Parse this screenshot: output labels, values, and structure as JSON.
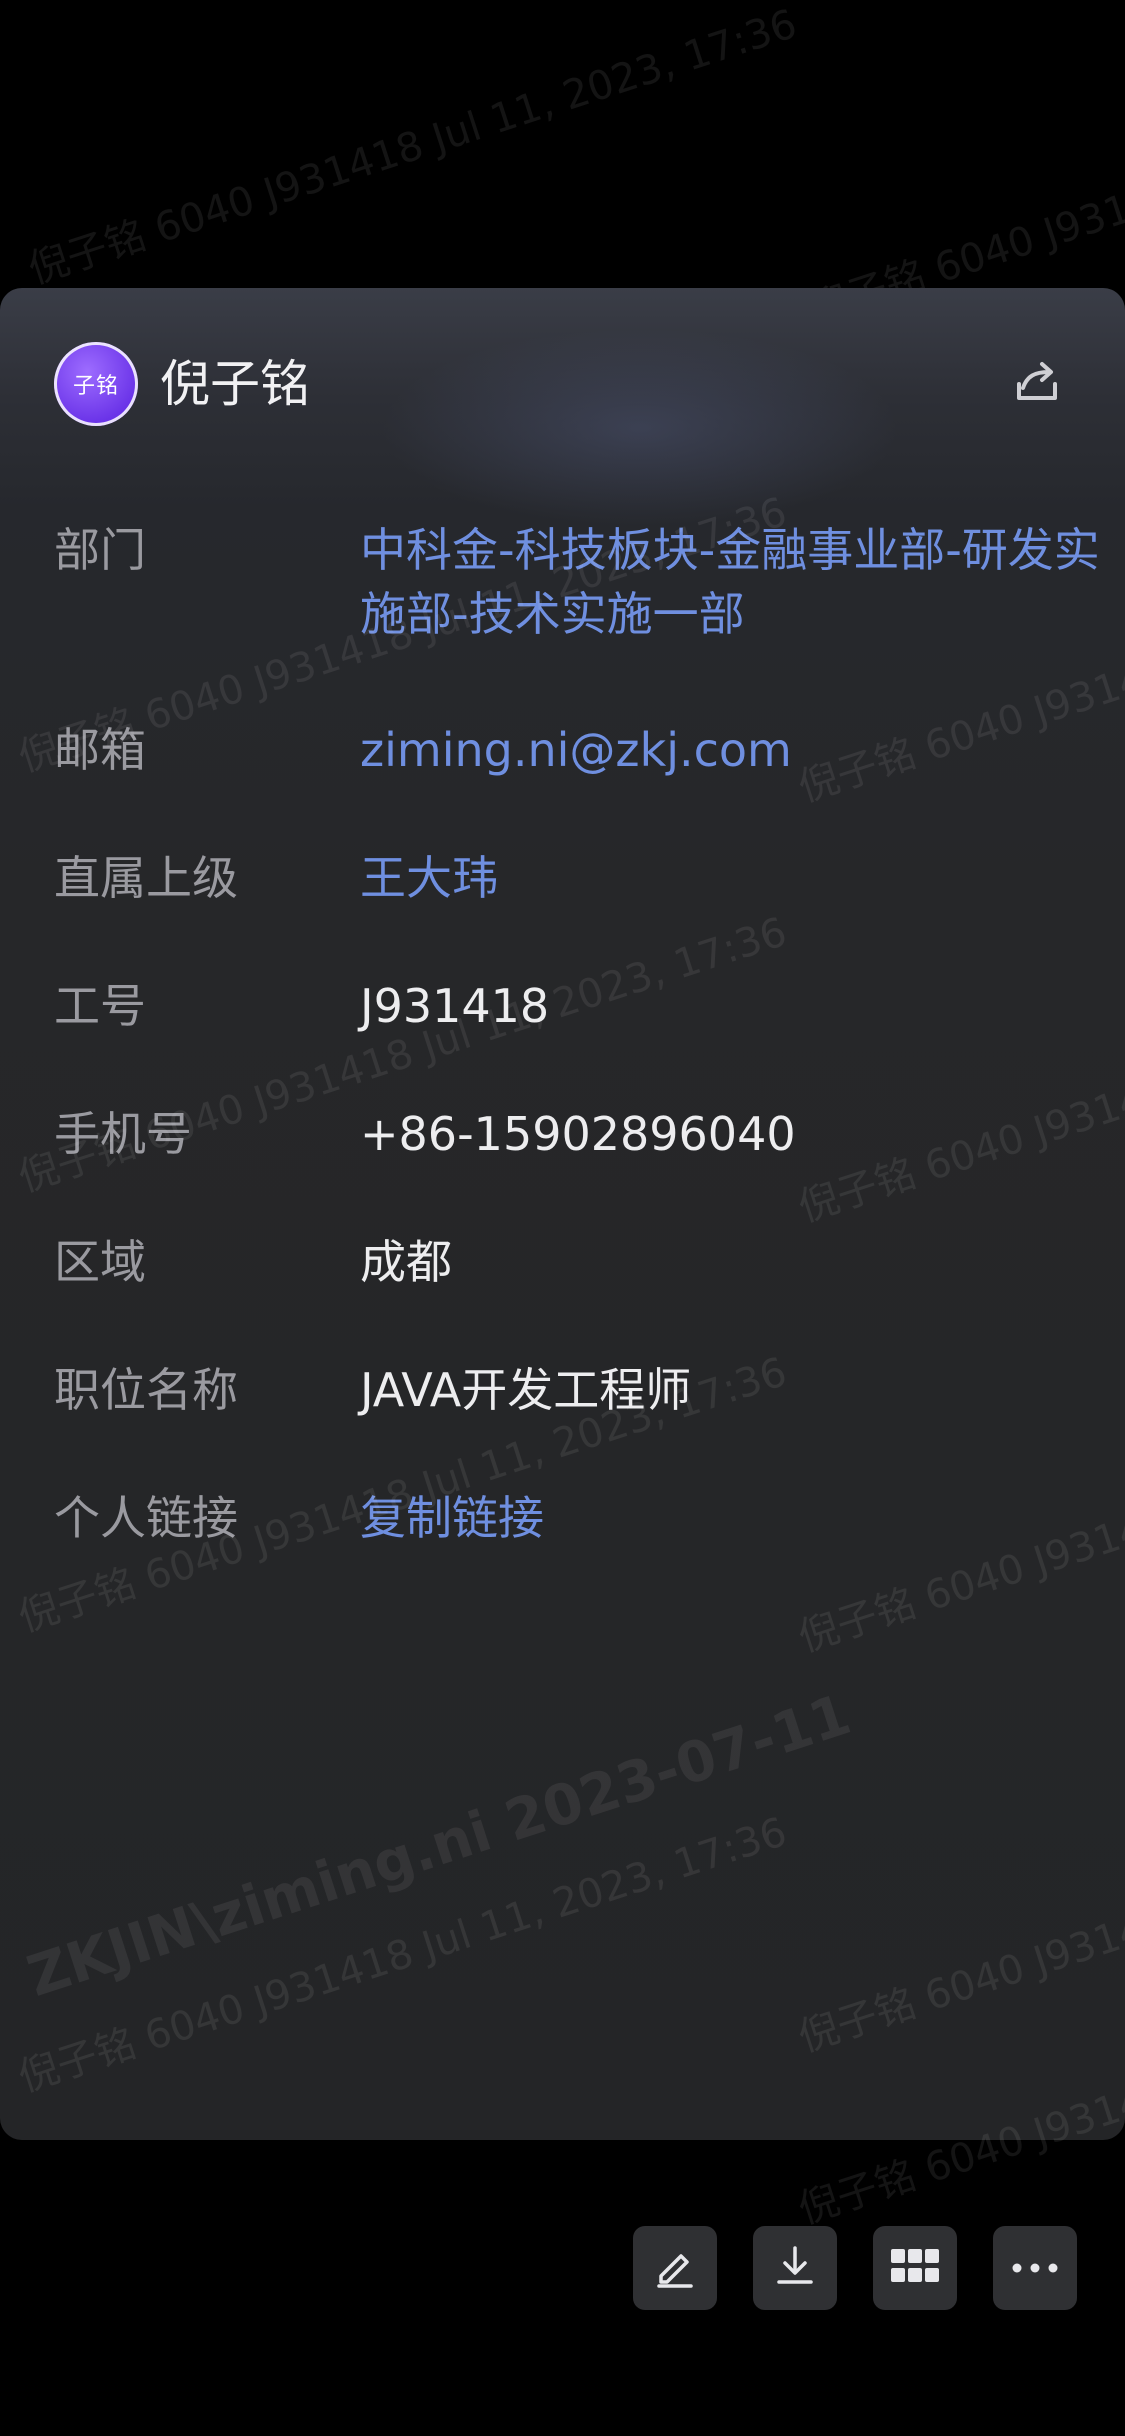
{
  "profile": {
    "avatar_text": "子铭",
    "name": "倪子铭"
  },
  "fields": [
    {
      "label": "部门",
      "value": "中科金-科技板块-金融事业部-研发实施部-技术实施一部"
    },
    {
      "label": "邮箱",
      "value": "ziming.ni@zkj.com"
    },
    {
      "label": "直属上级",
      "value": "王大玮"
    },
    {
      "label": "工号",
      "value": "J931418"
    },
    {
      "label": "手机号",
      "value": "+86-15902896040"
    },
    {
      "label": "区域",
      "value": "成都"
    },
    {
      "label": "职位名称",
      "value": "JAVA开发工程师"
    },
    {
      "label": "个人链接",
      "value": "复制链接"
    }
  ],
  "watermark": {
    "line1": "倪子铭 6040 J931418 Jul 11, 2023, 17:36",
    "line2": "ZKJIN\\ziming.ni  2023-07-11"
  },
  "toolbar_icons": [
    "pencil-icon",
    "download-icon",
    "grid-icon",
    "more-icon"
  ],
  "colors": {
    "link": "#6f8fe0",
    "avatar": "#7c4dff"
  }
}
